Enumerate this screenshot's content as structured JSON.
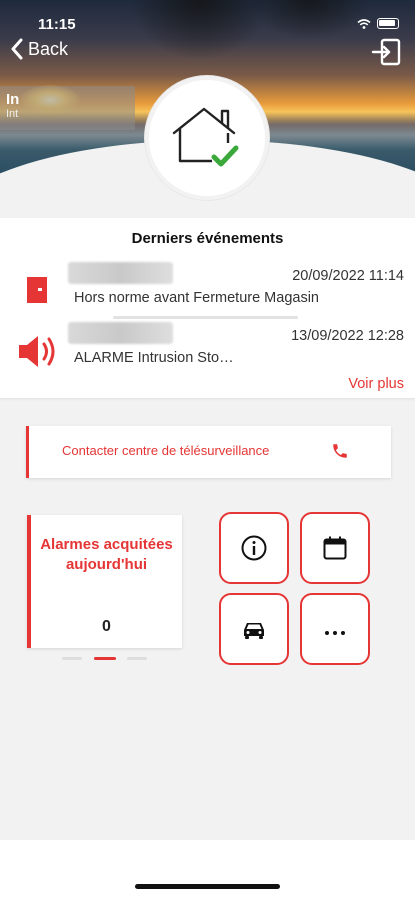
{
  "status_bar": {
    "time": "11:15"
  },
  "nav": {
    "back_label": "Back"
  },
  "site": {
    "name": "In",
    "subtitle": "Int"
  },
  "events": {
    "title": "Derniers événements",
    "items": [
      {
        "date": "20/09/2022 11:14",
        "description": "Hors norme avant Fermeture Magasin",
        "icon": "door-icon"
      },
      {
        "date": "13/09/2022 12:28",
        "description": "ALARME Intrusion Sto…",
        "icon": "siren-speaker-icon"
      }
    ],
    "see_more": "Voir plus"
  },
  "contact": {
    "label": "Contacter centre de télésurveillance",
    "icon": "phone-icon"
  },
  "alarm_card": {
    "title": "Alarmes acquitées aujourd'hui",
    "count": "0"
  },
  "quick_actions": [
    {
      "name": "info",
      "icon": "info-icon"
    },
    {
      "name": "calendar",
      "icon": "calendar-icon"
    },
    {
      "name": "vehicle",
      "icon": "car-icon"
    },
    {
      "name": "more",
      "icon": "more-icon"
    }
  ],
  "colors": {
    "accent": "#e53535",
    "ok": "#3aa83a",
    "background": "#f2f2f2"
  }
}
